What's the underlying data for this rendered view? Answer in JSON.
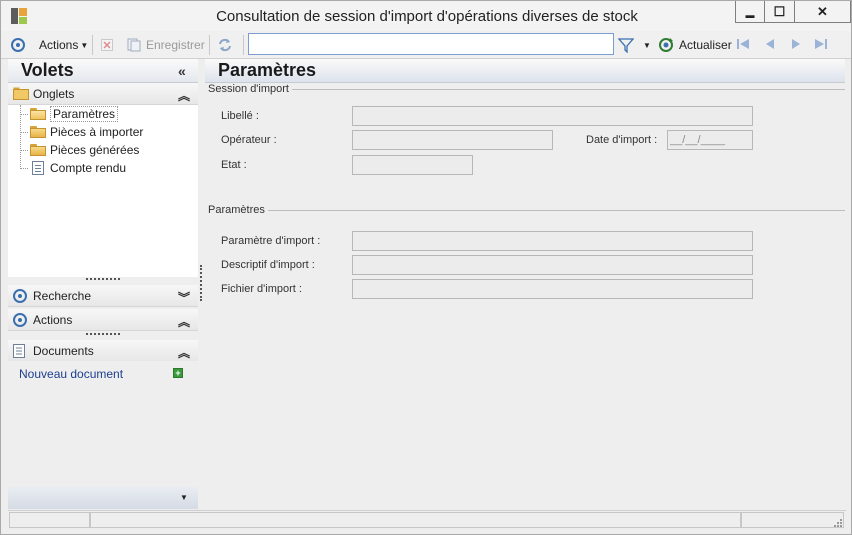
{
  "window": {
    "title": "Consultation de session d'import d'opérations diverses de stock",
    "controls": [
      "▬",
      "☐",
      "✕"
    ]
  },
  "toolbar": {
    "actions_label": "Actions",
    "enregistrer_label": "Enregistrer",
    "search_value": "",
    "actualiser_label": "Actualiser"
  },
  "left_panel": {
    "title": "Volets",
    "onglets": {
      "label": "Onglets",
      "items": [
        {
          "label": "Paramètres",
          "icon": "open-folder-icon",
          "selected": true
        },
        {
          "label": "Pièces à importer",
          "icon": "folder-icon"
        },
        {
          "label": "Pièces générées",
          "icon": "folder-icon"
        },
        {
          "label": "Compte rendu",
          "icon": "document-icon"
        }
      ]
    },
    "recherche_label": "Recherche",
    "actions_label": "Actions",
    "documents": {
      "label": "Documents",
      "new_document_label": "Nouveau document"
    }
  },
  "main": {
    "title": "Paramètres",
    "session_group": {
      "title": "Session d'import",
      "libelle_label": "Libellé :",
      "libelle_value": "",
      "operateur_label": "Opérateur :",
      "operateur_value": "",
      "date_label": "Date d'import :",
      "date_value": "__/__/____",
      "etat_label": "Etat :",
      "etat_value": ""
    },
    "params_group": {
      "title": "Paramètres",
      "parametre_label": "Paramètre d'import :",
      "parametre_value": "",
      "descriptif_label": "Descriptif d'import :",
      "descriptif_value": "",
      "fichier_label": "Fichier d'import :",
      "fichier_value": ""
    }
  },
  "colors": {
    "accent": "#3a6fb0",
    "panel_bg": "#eeeeee",
    "link": "#1d3f8f"
  }
}
